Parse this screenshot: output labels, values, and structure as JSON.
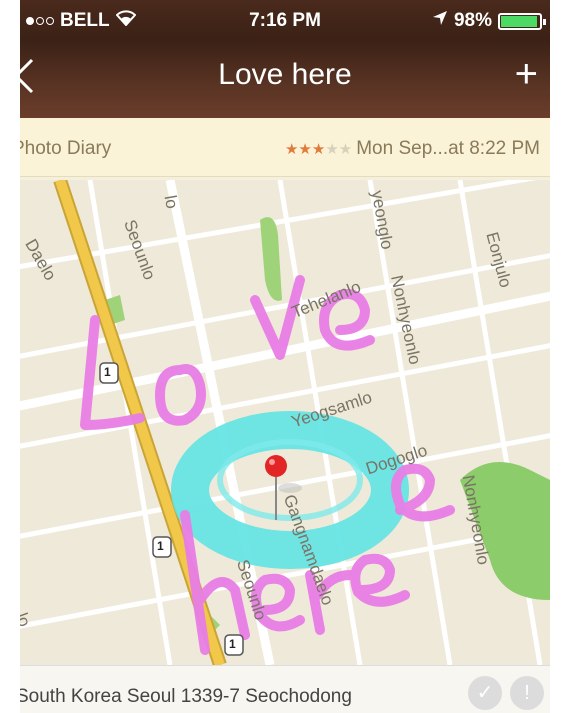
{
  "status_bar": {
    "carrier": "BELL",
    "time": "7:16 PM",
    "battery_percent": "98%",
    "battery_level": 0.98,
    "signal_bars": 1
  },
  "nav": {
    "title": "Love here",
    "back_icon": "chevron-left-icon",
    "add_label": "+"
  },
  "info": {
    "diary_label": "Photo Diary",
    "rating": 3,
    "rating_max": 5,
    "datetime": "Mon Sep...at 8:22 PM",
    "accent": "#e07b39"
  },
  "map": {
    "labels": {
      "daelo": "Daelo",
      "seounlo_top": "Seounlo",
      "lo_top": "lo",
      "yeongdong": "yeonglo",
      "tehelanlo": "Tehelanlo",
      "nonhyeonlo_top": "Nonhyeonlo",
      "eonjulo": "Eonjulo",
      "yeogsamlo": "Yeogsamlo",
      "dogoglo": "Dogoglo",
      "nonhyeonlo_bottom": "Nonhyeonlo",
      "gangnamdaelo": "Gangnamdaelo",
      "seounlo_bottom": "Seounlo",
      "lo_left": "lo"
    },
    "route_badge": "1",
    "handwriting": [
      "Love",
      "here"
    ],
    "colors": {
      "road_major": "#f2c84b",
      "drawing_pink": "#e87ee6",
      "drawing_cyan": "#5fe3e3",
      "park": "#9fd37a",
      "pin": "#e22525"
    }
  },
  "address": {
    "text": "South Korea Seoul 1339-7 Seochodong",
    "check_icon": "check-icon",
    "info_icon": "exclamation-icon"
  }
}
